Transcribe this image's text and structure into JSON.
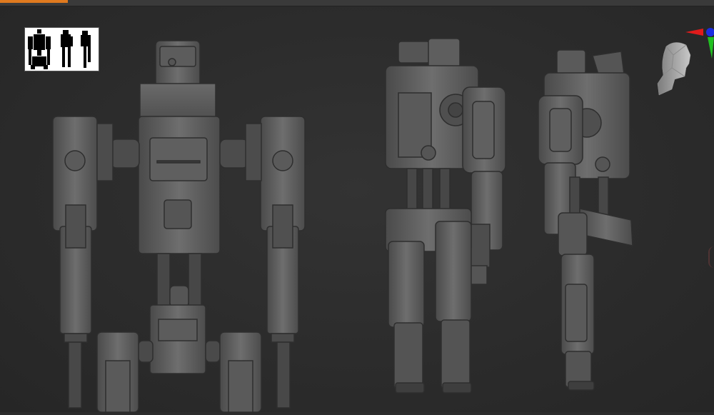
{
  "app": {
    "accent_color": "#e07a1f",
    "viewport_background": "#2c2c2c"
  },
  "viewport": {
    "thumbnail": {
      "icon": "silhouette-thumbnail"
    },
    "navigation": {
      "gizmo_icon": "axis-gizmo-icon",
      "head_icon": "head-orientation-icon"
    },
    "model_views": [
      {
        "name": "front"
      },
      {
        "name": "back-three-quarter"
      },
      {
        "name": "side"
      }
    ]
  }
}
